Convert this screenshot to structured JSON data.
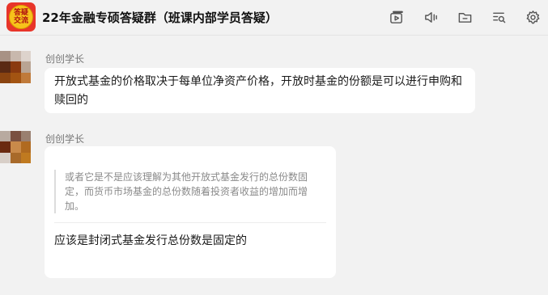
{
  "header": {
    "title": "22年金融专硕答疑群（班课内部学员答疑）",
    "avatar_line1": "答疑",
    "avatar_line2": "交流",
    "icons": [
      "video-icon",
      "voice-icon",
      "folder-icon",
      "search-list-icon",
      "gear-icon"
    ]
  },
  "messages": [
    {
      "sender": "创创学长",
      "text": "开放式基金的价格取决于每单位净资产价格，开放时基金的份额是可以进行申购和赎回的"
    },
    {
      "sender": "创创学长",
      "quote": "或者它是不是应该理解为其他开放式基金发行的总份数固定，而货币市场基金的总份数随着投资者收益的增加而增加。",
      "text": "应该是封闭式基金发行总份数是固定的"
    }
  ],
  "colors": {
    "background": "#f2f2f2",
    "bubble": "#ffffff",
    "group_avatar_bg": "#e8352a",
    "group_avatar_badge": "#f7c21b"
  }
}
